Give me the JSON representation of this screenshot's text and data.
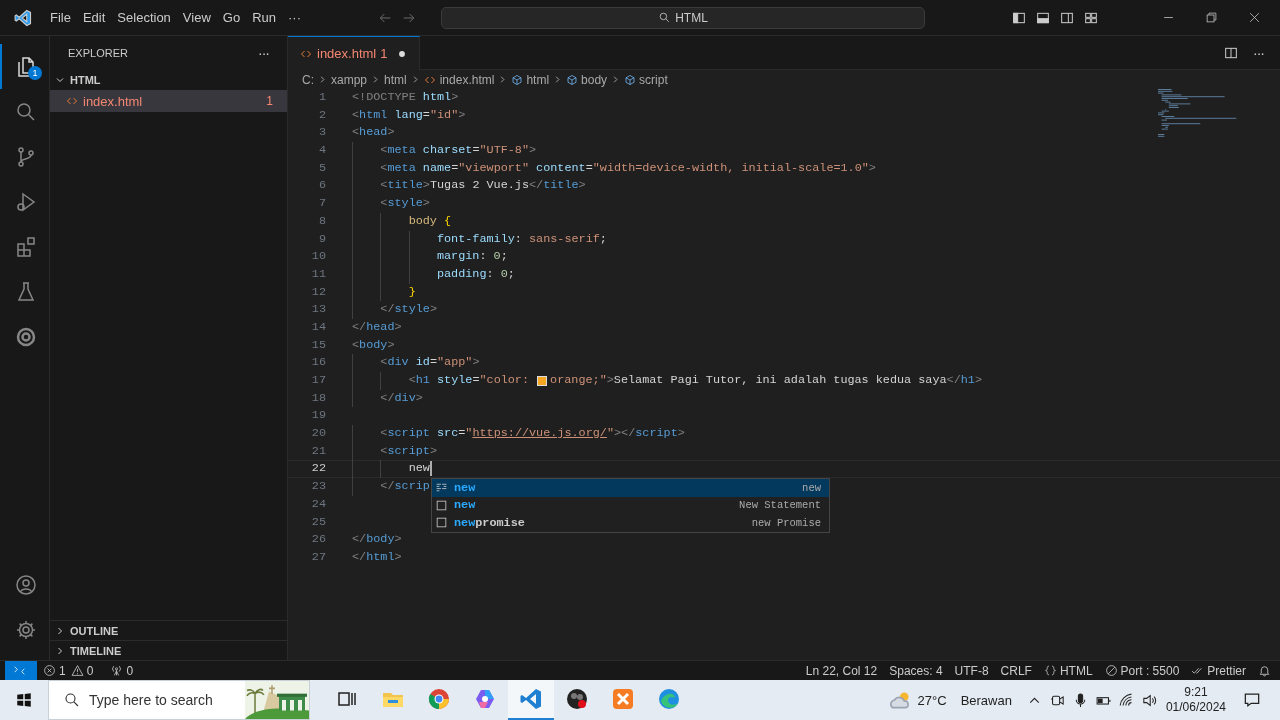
{
  "title_bar": {
    "menu": [
      "File",
      "Edit",
      "Selection",
      "View",
      "Go",
      "Run"
    ],
    "more": "···",
    "search": "HTML"
  },
  "activity_bar": {
    "items": [
      {
        "kind": "explorer",
        "selected": true,
        "badge": "1"
      },
      {
        "kind": "search",
        "selected": false
      },
      {
        "kind": "source-control",
        "selected": false
      },
      {
        "kind": "run-debug",
        "selected": false
      },
      {
        "kind": "extensions",
        "selected": false
      },
      {
        "kind": "testing",
        "selected": false
      },
      {
        "kind": "target",
        "selected": false
      }
    ],
    "bottom": [
      {
        "kind": "account"
      },
      {
        "kind": "settings"
      }
    ]
  },
  "sidebar": {
    "title": "EXPLORER",
    "more": "···",
    "folder": {
      "name": "HTML",
      "expanded": true,
      "files": [
        {
          "name": "index.html",
          "badge": "1",
          "selected": true
        }
      ]
    },
    "sections": [
      {
        "name": "OUTLINE",
        "expanded": false
      },
      {
        "name": "TIMELINE",
        "expanded": false
      }
    ]
  },
  "tabs": [
    {
      "label": "index.html",
      "badge": "1",
      "modified": true,
      "selected": true
    }
  ],
  "tab_actions_more": "···",
  "breadcrumbs": [
    {
      "kind": "plain",
      "text": "C:"
    },
    {
      "kind": "plain",
      "text": "xampp"
    },
    {
      "kind": "plain",
      "text": "html"
    },
    {
      "kind": "file",
      "text": "index.html"
    },
    {
      "kind": "symbol",
      "text": "html"
    },
    {
      "kind": "symbol",
      "text": "body"
    },
    {
      "kind": "symbol",
      "text": "script"
    }
  ],
  "editor": {
    "lines": [
      {
        "number": "1",
        "current": false,
        "tokens": [
          {
            "kind": "bracket",
            "text": "<!DOCTYPE"
          },
          {
            "kind": "attr",
            "text": " html"
          },
          {
            "kind": "bracket",
            "text": ">"
          }
        ]
      },
      {
        "number": "2",
        "current": false,
        "tokens": [
          {
            "kind": "bracket",
            "text": "<"
          },
          {
            "kind": "tag",
            "text": "html"
          },
          {
            "kind": "attr",
            "text": " lang"
          },
          {
            "kind": "plain",
            "text": "="
          },
          {
            "kind": "string",
            "text": "\"id\""
          },
          {
            "kind": "bracket",
            "text": ">"
          }
        ]
      },
      {
        "number": "3",
        "current": false,
        "tokens": [
          {
            "kind": "bracket",
            "text": "<"
          },
          {
            "kind": "tag",
            "text": "head"
          },
          {
            "kind": "bracket",
            "text": ">"
          }
        ]
      },
      {
        "number": "4",
        "current": false,
        "tokens": [
          {
            "kind": "bracket",
            "text": "    <"
          },
          {
            "kind": "tag",
            "text": "meta"
          },
          {
            "kind": "attr",
            "text": " charset"
          },
          {
            "kind": "plain",
            "text": "="
          },
          {
            "kind": "string",
            "text": "\"UTF-8\""
          },
          {
            "kind": "bracket",
            "text": ">"
          }
        ]
      },
      {
        "number": "5",
        "current": false,
        "tokens": [
          {
            "kind": "bracket",
            "text": "    <"
          },
          {
            "kind": "tag",
            "text": "meta"
          },
          {
            "kind": "attr",
            "text": " name"
          },
          {
            "kind": "plain",
            "text": "="
          },
          {
            "kind": "string",
            "text": "\"viewport\""
          },
          {
            "kind": "attr",
            "text": " content"
          },
          {
            "kind": "plain",
            "text": "="
          },
          {
            "kind": "string",
            "text": "\"width=device-width, initial-scale=1.0\""
          },
          {
            "kind": "bracket",
            "text": ">"
          }
        ]
      },
      {
        "number": "6",
        "current": false,
        "tokens": [
          {
            "kind": "bracket",
            "text": "    <"
          },
          {
            "kind": "tag",
            "text": "title"
          },
          {
            "kind": "bracket",
            "text": ">"
          },
          {
            "kind": "plain",
            "text": "Tugas 2 Vue.js"
          },
          {
            "kind": "bracket",
            "text": "</"
          },
          {
            "kind": "tag",
            "text": "title"
          },
          {
            "kind": "bracket",
            "text": ">"
          }
        ]
      },
      {
        "number": "7",
        "current": false,
        "tokens": [
          {
            "kind": "bracket",
            "text": "    <"
          },
          {
            "kind": "tag",
            "text": "style"
          },
          {
            "kind": "bracket",
            "text": ">"
          }
        ]
      },
      {
        "number": "8",
        "current": false,
        "tokens": [
          {
            "kind": "selector",
            "text": "        body"
          },
          {
            "kind": "brace",
            "text": " {"
          }
        ]
      },
      {
        "number": "9",
        "current": false,
        "tokens": [
          {
            "kind": "property",
            "text": "            font-family"
          },
          {
            "kind": "plain",
            "text": ": "
          },
          {
            "kind": "string",
            "text": "sans-serif"
          },
          {
            "kind": "plain",
            "text": ";"
          }
        ]
      },
      {
        "number": "10",
        "current": false,
        "tokens": [
          {
            "kind": "property",
            "text": "            margin"
          },
          {
            "kind": "plain",
            "text": ": "
          },
          {
            "kind": "number",
            "text": "0"
          },
          {
            "kind": "plain",
            "text": ";"
          }
        ]
      },
      {
        "number": "11",
        "current": false,
        "tokens": [
          {
            "kind": "property",
            "text": "            padding"
          },
          {
            "kind": "plain",
            "text": ": "
          },
          {
            "kind": "number",
            "text": "0"
          },
          {
            "kind": "plain",
            "text": ";"
          }
        ]
      },
      {
        "number": "12",
        "current": false,
        "tokens": [
          {
            "kind": "brace",
            "text": "        }"
          }
        ]
      },
      {
        "number": "13",
        "current": false,
        "tokens": [
          {
            "kind": "bracket",
            "text": "    </"
          },
          {
            "kind": "tag",
            "text": "style"
          },
          {
            "kind": "bracket",
            "text": ">"
          }
        ]
      },
      {
        "number": "14",
        "current": false,
        "tokens": [
          {
            "kind": "bracket",
            "text": "</"
          },
          {
            "kind": "tag",
            "text": "head"
          },
          {
            "kind": "bracket",
            "text": ">"
          }
        ]
      },
      {
        "number": "15",
        "current": false,
        "tokens": [
          {
            "kind": "bracket",
            "text": "<"
          },
          {
            "kind": "tag",
            "text": "body"
          },
          {
            "kind": "bracket",
            "text": ">"
          }
        ]
      },
      {
        "number": "16",
        "current": false,
        "tokens": [
          {
            "kind": "bracket",
            "text": "    <"
          },
          {
            "kind": "tag",
            "text": "div"
          },
          {
            "kind": "attr",
            "text": " id"
          },
          {
            "kind": "plain",
            "text": "="
          },
          {
            "kind": "string",
            "text": "\"app\""
          },
          {
            "kind": "bracket",
            "text": ">"
          }
        ]
      },
      {
        "number": "17",
        "current": false,
        "tokens": [
          {
            "kind": "bracket",
            "text": "        <"
          },
          {
            "kind": "tag",
            "text": "h1"
          },
          {
            "kind": "attr",
            "text": " style"
          },
          {
            "kind": "plain",
            "text": "="
          },
          {
            "kind": "string",
            "text": "\"color: "
          },
          {
            "kind": "swatch",
            "color": "#f5a623"
          },
          {
            "kind": "string",
            "text": "orange;\""
          },
          {
            "kind": "bracket",
            "text": ">"
          },
          {
            "kind": "plain",
            "text": "Selamat Pagi Tutor, ini adalah tugas kedua saya"
          },
          {
            "kind": "bracket",
            "text": "</"
          },
          {
            "kind": "tag",
            "text": "h1"
          },
          {
            "kind": "bracket",
            "text": ">"
          }
        ]
      },
      {
        "number": "18",
        "current": false,
        "tokens": [
          {
            "kind": "bracket",
            "text": "    </"
          },
          {
            "kind": "tag",
            "text": "div"
          },
          {
            "kind": "bracket",
            "text": ">"
          }
        ]
      },
      {
        "number": "19",
        "current": false
      },
      {
        "number": "20",
        "current": false,
        "tokens": [
          {
            "kind": "bracket",
            "text": "    <"
          },
          {
            "kind": "tag",
            "text": "script"
          },
          {
            "kind": "attr",
            "text": " src"
          },
          {
            "kind": "plain",
            "text": "="
          },
          {
            "kind": "string",
            "text": "\""
          },
          {
            "kind": "link",
            "text": "https://vue.js.org/"
          },
          {
            "kind": "string",
            "text": "\""
          },
          {
            "kind": "bracket",
            "text": "></"
          },
          {
            "kind": "tag",
            "text": "script"
          },
          {
            "kind": "bracket",
            "text": ">"
          }
        ]
      },
      {
        "number": "21",
        "current": false,
        "tokens": [
          {
            "kind": "bracket",
            "text": "    <"
          },
          {
            "kind": "tag",
            "text": "script"
          },
          {
            "kind": "bracket",
            "text": ">"
          }
        ]
      },
      {
        "number": "22",
        "current": true,
        "tokens": [
          {
            "kind": "plain",
            "text": "        new"
          }
        ]
      },
      {
        "number": "23",
        "current": false,
        "tokens": [
          {
            "kind": "bracket",
            "text": "    </"
          },
          {
            "kind": "tag",
            "text": "scrip"
          }
        ]
      },
      {
        "number": "24",
        "current": false
      },
      {
        "number": "25",
        "current": false
      },
      {
        "number": "26",
        "current": false,
        "tokens": [
          {
            "kind": "bracket",
            "text": "</"
          },
          {
            "kind": "tag",
            "text": "body"
          },
          {
            "kind": "bracket",
            "text": ">"
          }
        ]
      },
      {
        "number": "27",
        "current": false,
        "tokens": [
          {
            "kind": "bracket",
            "text": "</"
          },
          {
            "kind": "tag",
            "text": "html"
          },
          {
            "kind": "bracket",
            "text": ">"
          }
        ]
      }
    ],
    "suggestions": [
      {
        "kind": "keyword",
        "match": "new",
        "detail": "new",
        "selected": true
      },
      {
        "kind": "snippet",
        "match": "new",
        "detail": "New Statement",
        "selected": false
      },
      {
        "kind": "snippet",
        "match": "new",
        "rest": "promise",
        "detail": "new Promise",
        "selected": false
      }
    ]
  },
  "status_bar": {
    "errors": "1",
    "warnings": "0",
    "ports": "0",
    "items": [
      {
        "kind": "position",
        "text": "Ln 22, Col 12"
      },
      {
        "kind": "spaces",
        "text": "Spaces: 4"
      },
      {
        "kind": "encoding",
        "text": "UTF-8"
      },
      {
        "kind": "eol",
        "text": "CRLF"
      },
      {
        "kind": "language",
        "text": "HTML"
      },
      {
        "kind": "port",
        "text": "Port : 5500"
      },
      {
        "kind": "formatter",
        "text": "Prettier"
      },
      {
        "kind": "notifications"
      }
    ]
  },
  "taskbar": {
    "search_placeholder": "Type here to search",
    "apps": [
      {
        "kind": "task-view",
        "active": false
      },
      {
        "kind": "file-explorer",
        "active": false
      },
      {
        "kind": "chrome",
        "active": false
      },
      {
        "kind": "copilot",
        "active": false
      },
      {
        "kind": "vscode",
        "active": true
      },
      {
        "kind": "obs",
        "active": false
      },
      {
        "kind": "xampp",
        "active": false
      },
      {
        "kind": "edge",
        "active": false
      }
    ],
    "weather": {
      "temperature": "27°C",
      "condition": "Berawan"
    },
    "time": "9:21",
    "date": "01/06/2024"
  }
}
